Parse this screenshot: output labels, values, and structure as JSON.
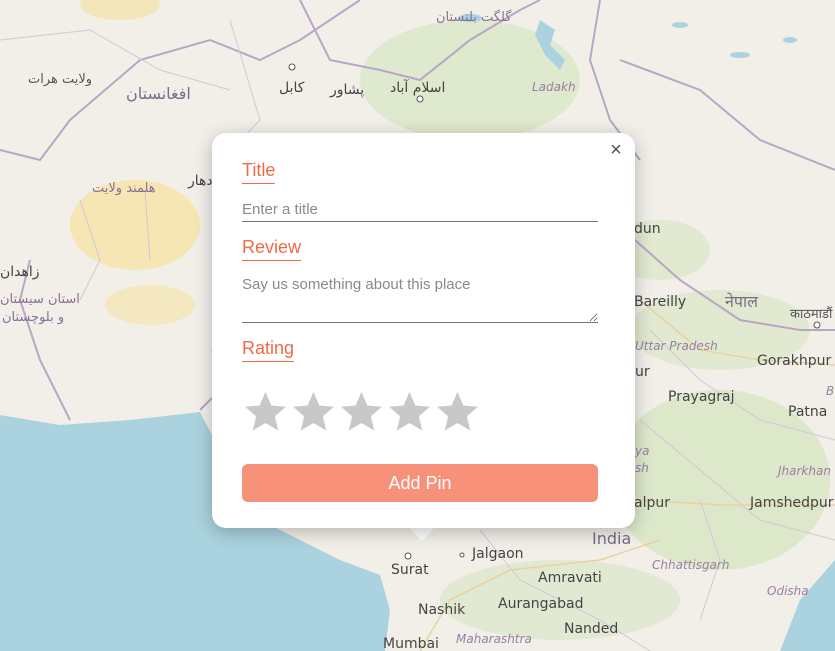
{
  "map": {
    "labels": {
      "afghanistan": "افغانستان",
      "herat": "ولایت هرات",
      "kabul": "کابل",
      "peshawar": "پشاور",
      "islamabad": "اسلام آباد",
      "gilgit": "گلگت بلتستان",
      "ladakh": "Ladakh",
      "helmand": "هلمند ولایت",
      "kandahar": "دهار",
      "zahedan": "زاهدان",
      "sistan1": "استان سیستان",
      "sistan2": "و بلوچستان",
      "dun": "dun",
      "bareilly": "Bareilly",
      "nepal": "नेपाल",
      "kathmandu": "काठमाडौं",
      "uttar_pradesh": "Uttar Pradesh",
      "gorakhpur": "Gorakhpur",
      "ur": "ur",
      "prayagraj": "Prayagraj",
      "patna": "Patna",
      "ya": "ya",
      "sh": "sh",
      "jharkhand": "Jharkhan",
      "jabalpur": "alpur",
      "jamshedpur": "Jamshedpur",
      "india": "India",
      "chhattisgarh": "Chhattisgarh",
      "odisha": "Odisha",
      "jalgaon": "Jalgaon",
      "surat": "Surat",
      "amravati": "Amravati",
      "nashik": "Nashik",
      "aurangabad": "Aurangabad",
      "nanded": "Nanded",
      "mumbai": "Mumbai",
      "maharashtra": "Maharashtra",
      "b_edge": "B"
    },
    "colors": {
      "land": "#f2efe9",
      "water": "#aad3df",
      "forest": "#cfe3b8",
      "desert": "#f5e3a6",
      "border": "#b9a6c4"
    }
  },
  "popup": {
    "close_icon": "×",
    "title_label": "Title",
    "title_placeholder": "Enter a title",
    "title_value": "",
    "review_label": "Review",
    "review_placeholder": "Say us something about this place",
    "review_value": "",
    "rating_label": "Rating",
    "rating_value": 0,
    "rating_max": 5,
    "star_color_empty": "#c8c8c8",
    "submit_label": "Add Pin",
    "accent_color": "#f26a45",
    "button_color": "#f7917a"
  }
}
